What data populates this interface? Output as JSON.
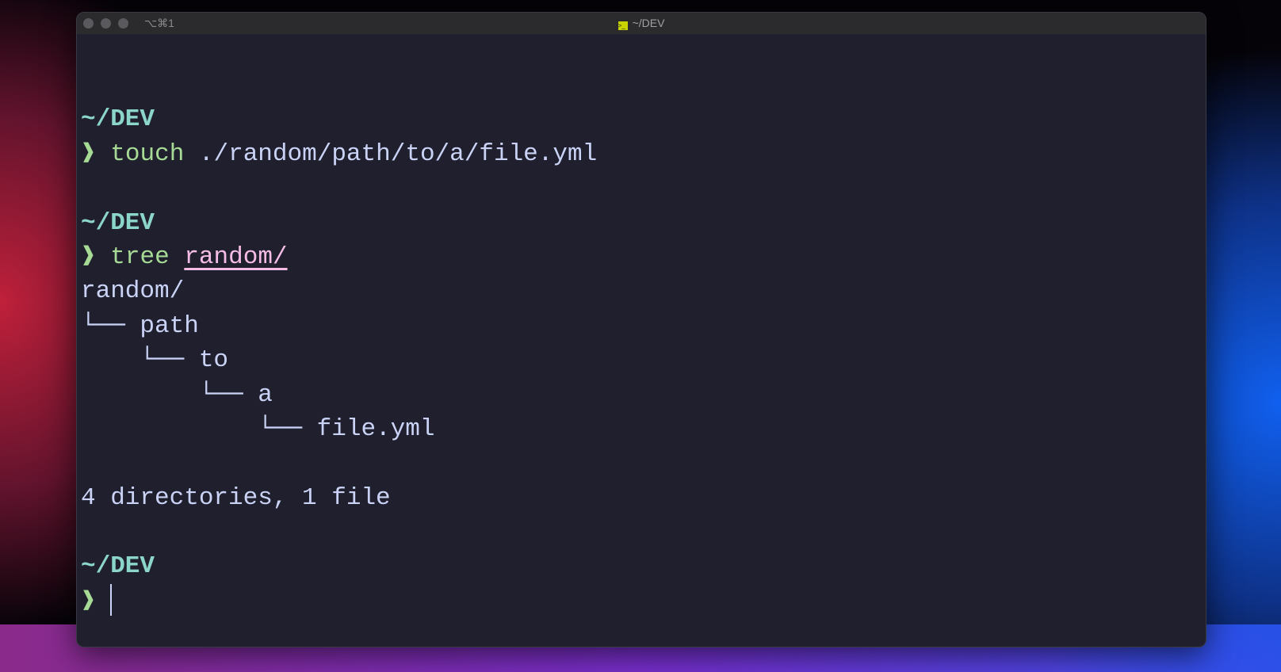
{
  "window": {
    "shortcut": "⌥⌘1",
    "title": "~/DEV",
    "title_icon": "terminal-icon"
  },
  "colors": {
    "background": "#1f1f2e",
    "cwd": "#8bd5ca",
    "prompt": "#a6da95",
    "text": "#cad3f5",
    "path_arg": "#f5bde6"
  },
  "terminal": {
    "prompt_symbol": "❱",
    "blocks": [
      {
        "cwd": "~/DEV",
        "command": "touch",
        "args": " ./random/path/to/a/file.yml"
      },
      {
        "cwd": "~/DEV",
        "command": "tree",
        "args": "random/",
        "output": [
          "random/",
          "└── path",
          "    └── to",
          "        └── a",
          "            └── file.yml",
          "",
          "4 directories, 1 file"
        ]
      },
      {
        "cwd": "~/DEV"
      }
    ]
  }
}
